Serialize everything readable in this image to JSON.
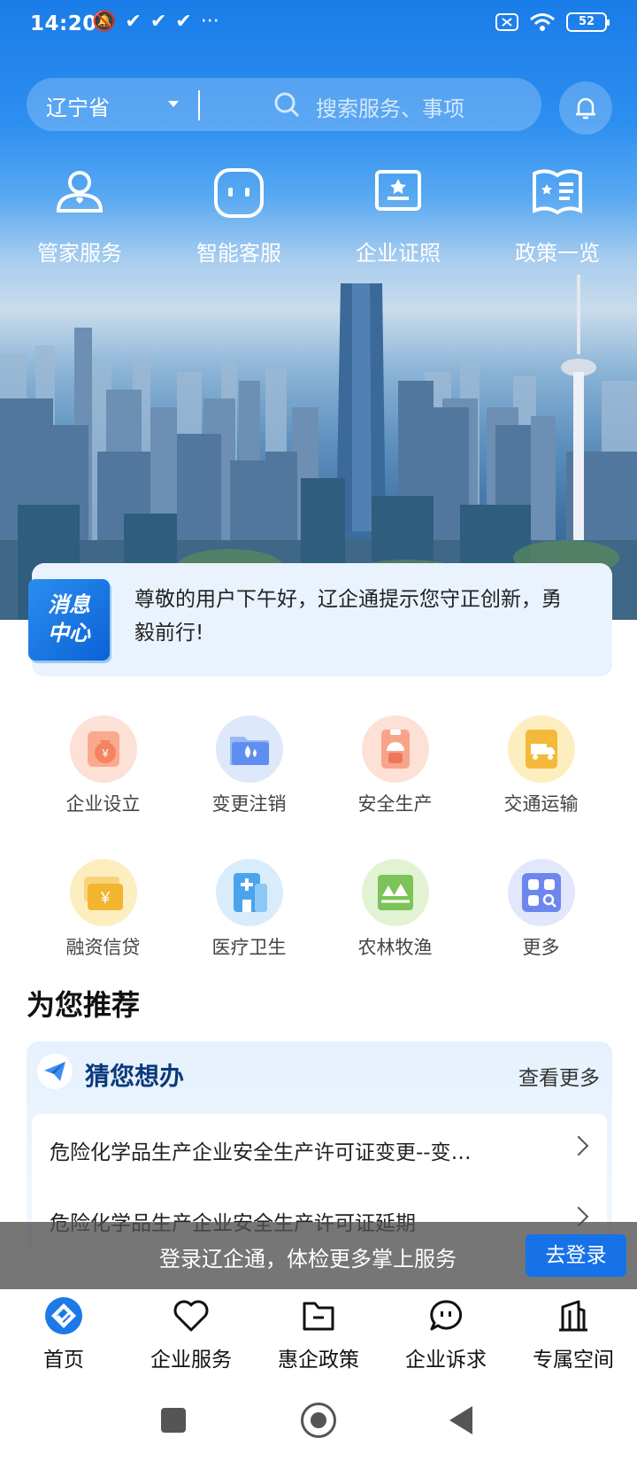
{
  "status_bar": {
    "time": "14:20",
    "notif_icons": [
      "muted-icon",
      "check-icon",
      "check-icon",
      "check-icon",
      "more-icon"
    ],
    "battery": "52"
  },
  "search": {
    "region": "辽宁省",
    "placeholder": "搜索服务、事项"
  },
  "top_shortcuts": [
    {
      "label": "管家服务",
      "icon": "butler-icon"
    },
    {
      "label": "智能客服",
      "icon": "robot-icon"
    },
    {
      "label": "企业证照",
      "icon": "certificate-icon"
    },
    {
      "label": "政策一览",
      "icon": "policy-book-icon"
    }
  ],
  "message_center": {
    "badge_line1": "消息",
    "badge_line2": "中心",
    "text": "尊敬的用户下午好，辽企通提示您守正创新，勇毅前行!"
  },
  "services": [
    {
      "label": "企业设立",
      "icon": "money-bag-icon",
      "bg": "#fde0d6",
      "fg": "#f4835f"
    },
    {
      "label": "变更注销",
      "icon": "folder-drop-icon",
      "bg": "#dde8fb",
      "fg": "#5e8ff0"
    },
    {
      "label": "安全生产",
      "icon": "worker-icon",
      "bg": "#fde0d6",
      "fg": "#f0765a"
    },
    {
      "label": "交通运输",
      "icon": "truck-icon",
      "bg": "#fdeebf",
      "fg": "#f4b93a"
    },
    {
      "label": "融资信贷",
      "icon": "yuan-wallet-icon",
      "bg": "#fdeebf",
      "fg": "#f3b52f"
    },
    {
      "label": "医疗卫生",
      "icon": "medical-icon",
      "bg": "#d9ecfb",
      "fg": "#4aa4ec"
    },
    {
      "label": "农林牧渔",
      "icon": "forest-icon",
      "bg": "#e2f3d3",
      "fg": "#7cc35a"
    },
    {
      "label": "更多",
      "icon": "grid-more-icon",
      "bg": "#e2e7fb",
      "fg": "#6d87ee"
    }
  ],
  "recommend": {
    "section_title": "为您推荐",
    "card_title": "猜您想办",
    "more_label": "查看更多",
    "items": [
      "危险化学品生产企业安全生产许可证变更--变…",
      "危险化学品生产企业安全生产许可证延期"
    ]
  },
  "login_banner": {
    "text": "登录辽企通，体检更多掌上服务",
    "button": "去登录"
  },
  "tabbar": [
    {
      "label": "首页",
      "icon": "home-logo-icon",
      "active": true
    },
    {
      "label": "企业服务",
      "icon": "heart-icon"
    },
    {
      "label": "惠企政策",
      "icon": "folder-icon"
    },
    {
      "label": "企业诉求",
      "icon": "chat-icon"
    },
    {
      "label": "专属空间",
      "icon": "building-icon"
    }
  ],
  "colors": {
    "primary": "#1672e6",
    "hero_top": "#1a7ce8"
  }
}
